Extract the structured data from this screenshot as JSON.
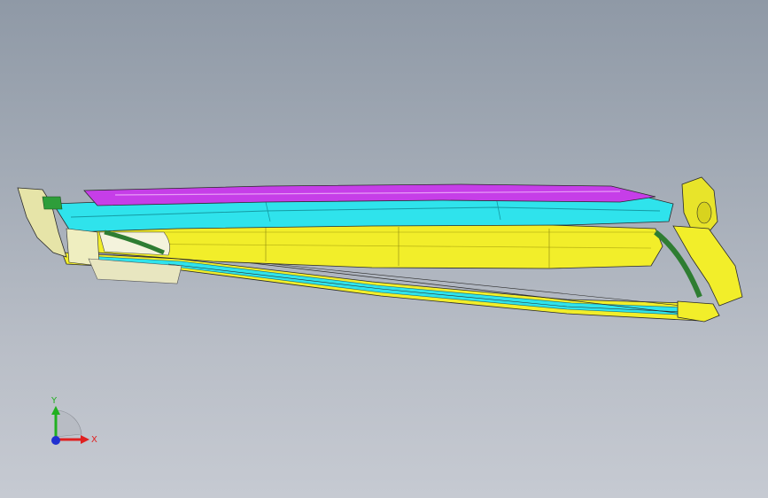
{
  "viewport": {
    "background_top": "#8f99a6",
    "background_bottom": "#c6cad2"
  },
  "model": {
    "colors": {
      "yellow": "#f2ee2a",
      "yellow_dark": "#bdb815",
      "cyan": "#2fe3ec",
      "cyan_dark": "#159aa3",
      "magenta": "#c63ee8",
      "green": "#2e7d32",
      "light_yellow": "#efeec0",
      "pale": "#e6e4c8",
      "outline": "#2a2a2a"
    }
  },
  "triad": {
    "x_label": "X",
    "y_label": "Y",
    "x_color": "#e02020",
    "y_color": "#20b020",
    "z_color": "#2030d0"
  }
}
